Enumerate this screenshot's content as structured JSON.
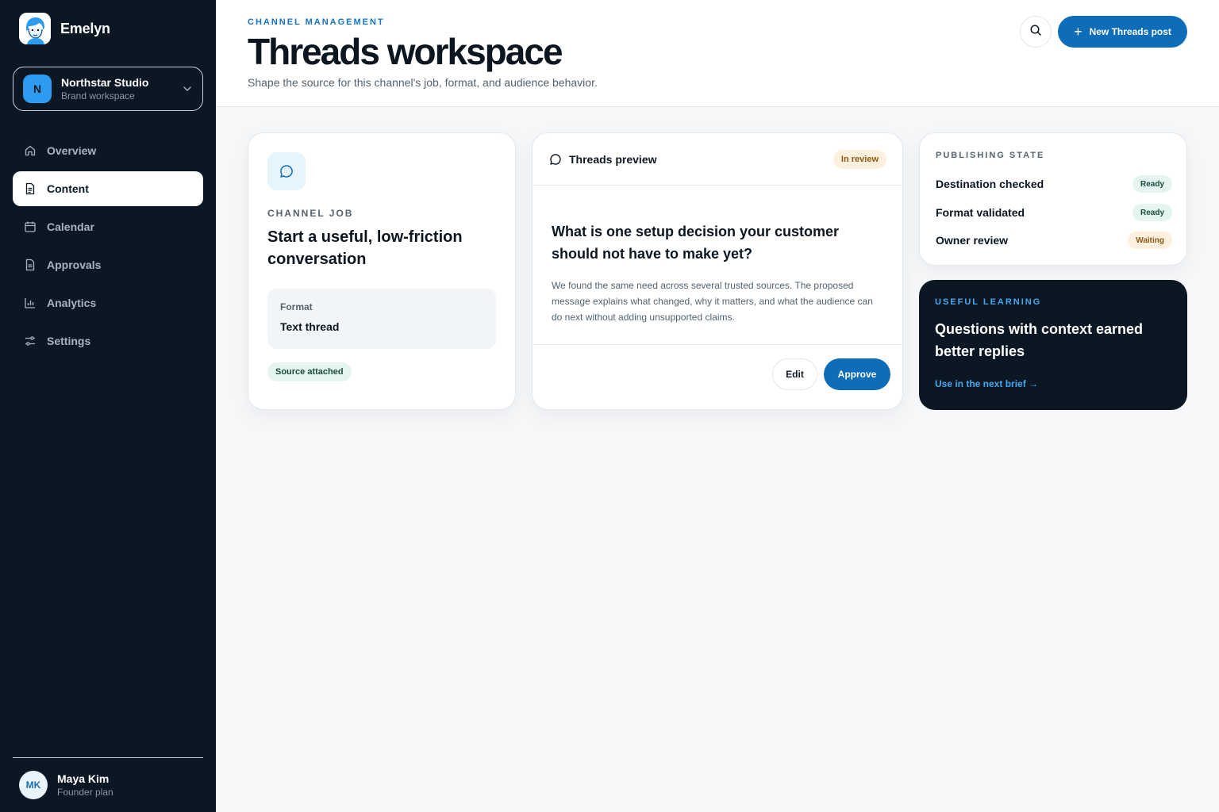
{
  "app": {
    "brand_name": "Emelyn"
  },
  "workspace": {
    "initial": "N",
    "name": "Northstar Studio",
    "subtitle": "Brand workspace"
  },
  "sidebar": {
    "items": [
      {
        "label": "Overview",
        "icon": "home-icon",
        "active": false
      },
      {
        "label": "Content",
        "icon": "document-icon",
        "active": true
      },
      {
        "label": "Calendar",
        "icon": "calendar-icon",
        "active": false
      },
      {
        "label": "Approvals",
        "icon": "document-check-icon",
        "active": false
      },
      {
        "label": "Analytics",
        "icon": "bar-chart-icon",
        "active": false
      },
      {
        "label": "Settings",
        "icon": "sliders-icon",
        "active": false
      }
    ]
  },
  "user": {
    "initials": "MK",
    "name": "Maya Kim",
    "plan": "Founder plan"
  },
  "header": {
    "eyebrow": "CHANNEL MANAGEMENT",
    "title": "Threads workspace",
    "subtitle": "Shape the source for this channel's job, format, and audience behavior.",
    "new_post_label": "New Threads post"
  },
  "channel_job": {
    "label": "CHANNEL JOB",
    "title": "Start a useful, low-friction conversation",
    "format_label": "Format",
    "format_value": "Text thread",
    "source_badge": "Source attached"
  },
  "preview": {
    "title": "Threads preview",
    "status": "In review",
    "question": "What is one setup decision your customer should not have to make yet?",
    "body": "We found the same need across several trusted sources. The proposed message explains what changed, why it matters, and what the audience can do next without adding unsupported claims.",
    "edit_label": "Edit",
    "approve_label": "Approve"
  },
  "publishing_state": {
    "label": "PUBLISHING STATE",
    "rows": [
      {
        "name": "Destination checked",
        "status": "Ready"
      },
      {
        "name": "Format validated",
        "status": "Ready"
      },
      {
        "name": "Owner review",
        "status": "Waiting"
      }
    ]
  },
  "learning": {
    "label": "USEFUL LEARNING",
    "title": "Questions with context earned better replies",
    "link": "Use in the next brief →"
  },
  "colors": {
    "sidebar_bg": "#0b1723",
    "accent": "#0e6db8",
    "ready_bg": "#e4f5ee",
    "waiting_bg": "#fdf0de"
  }
}
